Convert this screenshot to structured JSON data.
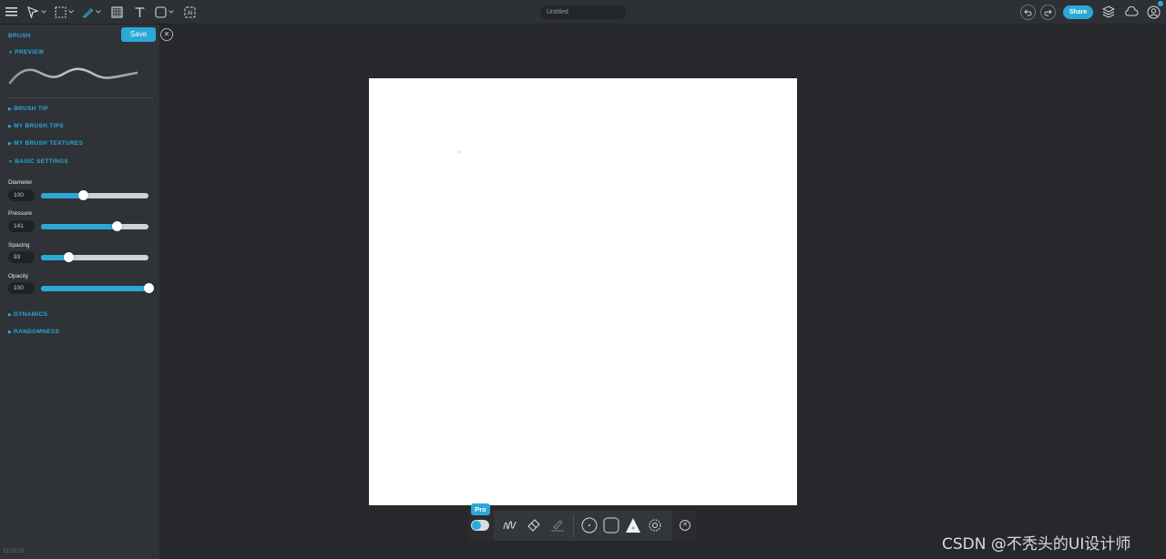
{
  "topbar": {
    "document_title": "Untitled",
    "share_label": "Share",
    "tools": [
      "menu-icon",
      "select-arrow-icon",
      "marquee-select-icon",
      "brush-icon",
      "texture-icon",
      "text-icon",
      "shape-icon",
      "ai-icon"
    ]
  },
  "sidebar": {
    "title": "BRUSH",
    "save_label": "Save",
    "sections": {
      "preview": "PREVIEW",
      "brush_tip": "BRUSH TIP",
      "my_brush_tips": "MY BRUSH TIPS",
      "my_brush_textures": "MY BRUSH TEXTURES",
      "basic_settings": "BASIC SETTINGS",
      "dynamics": "DYNAMICS",
      "randomness": "RANDOMNESS"
    },
    "settings": [
      {
        "label": "Diameter",
        "value": "100",
        "level": 0.39
      },
      {
        "label": "Pressure",
        "value": "141",
        "level": 0.7
      },
      {
        "label": "Spacing",
        "value": "93",
        "level": 0.25
      },
      {
        "label": "Opacity",
        "value": "100",
        "level": 1.0
      }
    ]
  },
  "bottom_toolbar": {
    "pro_label": "Pro",
    "tools": [
      "stroke-icon",
      "eraser-icon",
      "smudge-icon",
      "circle-dot-icon",
      "rounded-square-icon",
      "triangle-icon",
      "settings-gear-icon",
      "close-icon"
    ]
  },
  "timestamp": "23:10:22",
  "watermark": "CSDN @不秃头的UI设计师",
  "colors": {
    "accent": "#2aa8d6",
    "background": "#26282b",
    "panel": "#2f3236"
  }
}
